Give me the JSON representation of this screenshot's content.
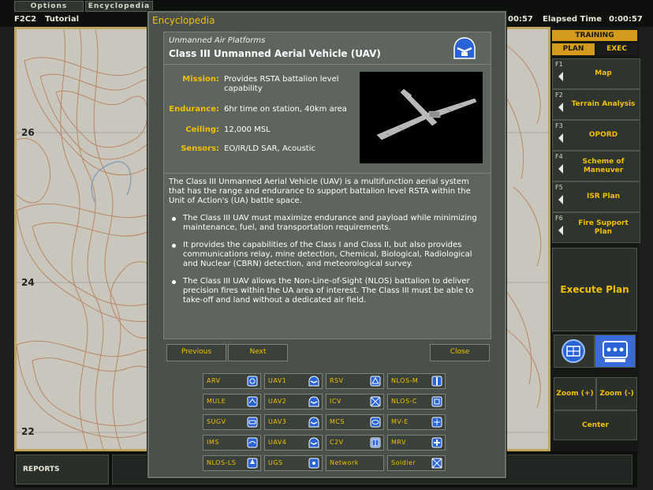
{
  "menu": {
    "options": "Options",
    "encyclopedia": "Encyclopedia"
  },
  "status": {
    "code": "F2C2",
    "mode": "Tutorial",
    "clock1": ":00:57",
    "elapsed_label": "Elapsed Time",
    "elapsed_value": "0:00:57"
  },
  "map": {
    "grid_labels": [
      "26",
      "24",
      "22"
    ]
  },
  "right_panel": {
    "training": "TRAINING",
    "plan": "PLAN",
    "exec": "EXEC",
    "functions": [
      {
        "key": "F1",
        "label": "Map"
      },
      {
        "key": "F2",
        "label": "Terrain Analysis"
      },
      {
        "key": "F3",
        "label": "OPORD"
      },
      {
        "key": "F4",
        "label": "Scheme of Maneuver"
      },
      {
        "key": "F5",
        "label": "ISR Plan"
      },
      {
        "key": "F6",
        "label": "Fire Support Plan"
      }
    ],
    "execute": "Execute Plan",
    "zoom_in": "Zoom (+)",
    "zoom_out": "Zoom (-)",
    "center": "Center"
  },
  "bottom": {
    "reports": "REPORTS"
  },
  "dialog": {
    "title": "Encyclopedia",
    "category": "Unmanned Air Platforms",
    "vehicle_title": "Class III Unmanned Aerial Vehicle (UAV)",
    "specs": [
      {
        "label": "Mission:",
        "value": "Provides RSTA battalion level capability"
      },
      {
        "label": "Endurance:",
        "value": "6hr time on station, 40km area"
      },
      {
        "label": "Ceiling:",
        "value": "12,000 MSL"
      },
      {
        "label": "Sensors:",
        "value": "EO/IR/LD SAR, Acoustic"
      }
    ],
    "intro": "The Class III Unmanned Aerial Vehicle (UAV) is a multifunction aerial system that has the range and endurance to support battalion level RSTA within the Unit of Action's (UA) battle space.",
    "bullets": [
      "The Class III UAV must maximize endurance and payload while minimizing maintenance, fuel, and transportation requirements.",
      "It provides the capabilities of the Class I and Class II, but also provides communications relay, mine detection, Chemical, Biological, Radiological and Nuclear (CBRN) detection, and meteorological survey.",
      "The Class III UAV allows the Non-Line-of-Sight (NLOS) battalion to deliver precision fires within the UA area of interest.  The Class III must be able to take-off and land without a dedicated air field."
    ],
    "previous": "Previous",
    "next": "Next",
    "close": "Close",
    "categories": [
      [
        "ARV",
        "UAV1",
        "RSV",
        "NLOS-M"
      ],
      [
        "MULE",
        "UAV2",
        "ICV",
        "NLOS-C"
      ],
      [
        "SUGV",
        "UAV3",
        "MCS",
        "MV-E"
      ],
      [
        "IMS",
        "UAV4",
        "C2V",
        "MRV"
      ],
      [
        "NLOS-LS",
        "UGS",
        "Network",
        "Soldier"
      ]
    ]
  },
  "colors": {
    "accent": "#f0c000",
    "panel": "#4a504a",
    "map_border": "#bfa55c",
    "contour": "#b4704a"
  }
}
